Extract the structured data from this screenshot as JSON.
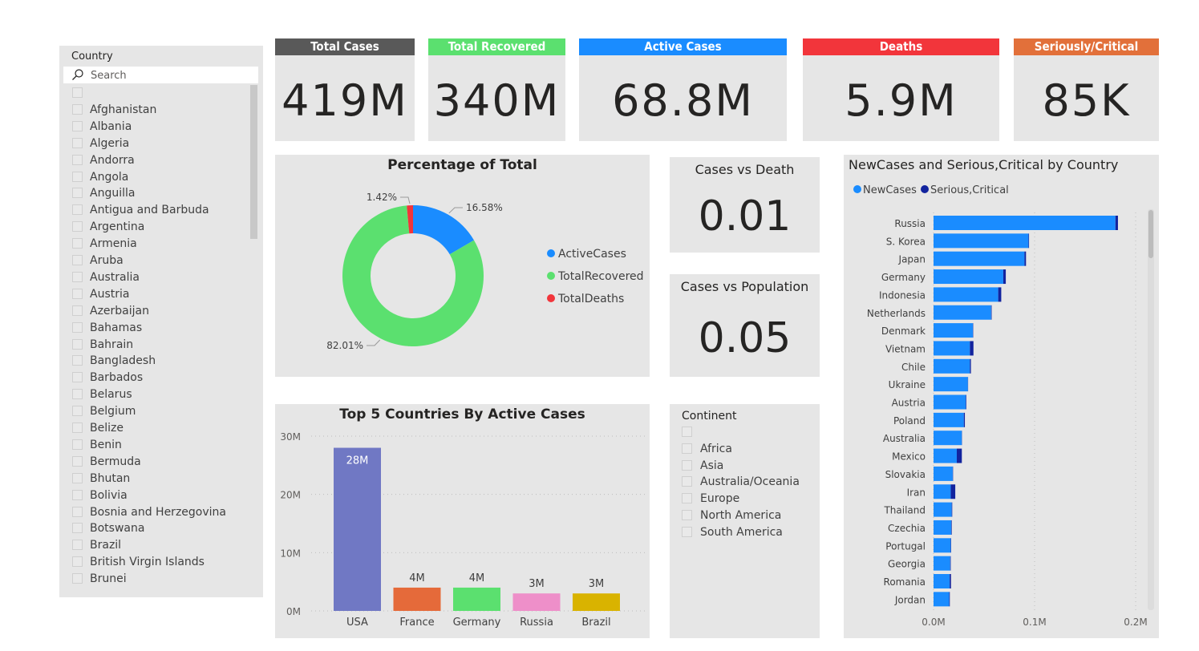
{
  "country_slicer": {
    "title": "Country",
    "search_placeholder": "Search",
    "items": [
      "",
      "Afghanistan",
      "Albania",
      "Algeria",
      "Andorra",
      "Angola",
      "Anguilla",
      "Antigua and Barbuda",
      "Argentina",
      "Armenia",
      "Aruba",
      "Australia",
      "Austria",
      "Azerbaijan",
      "Bahamas",
      "Bahrain",
      "Bangladesh",
      "Barbados",
      "Belarus",
      "Belgium",
      "Belize",
      "Benin",
      "Bermuda",
      "Bhutan",
      "Bolivia",
      "Bosnia and Herzegovina",
      "Botswana",
      "Brazil",
      "British Virgin Islands",
      "Brunei"
    ]
  },
  "kpis": {
    "total_cases": {
      "label": "Total Cases",
      "value": "419M",
      "color": "#595959"
    },
    "total_recovered": {
      "label": "Total Recovered",
      "value": "340M",
      "color": "#5be06f"
    },
    "active_cases": {
      "label": "Active Cases",
      "value": "68.8M",
      "color": "#1a8cff"
    },
    "deaths": {
      "label": "Deaths",
      "value": "5.9M",
      "color": "#f2353b"
    },
    "serious_critical": {
      "label": "Seriously/Critical",
      "value": "85K",
      "color": "#e2703a"
    }
  },
  "ratios": {
    "cases_vs_death": {
      "title": "Cases vs Death",
      "value": "0.01"
    },
    "cases_vs_population": {
      "title": "Cases vs Population",
      "value": "0.05"
    }
  },
  "continent_slicer": {
    "title": "Continent",
    "items": [
      "",
      "Africa",
      "Asia",
      "Australia/Oceania",
      "Europe",
      "North America",
      "South America"
    ]
  },
  "chart_data": [
    {
      "type": "pie",
      "title": "Percentage of Total",
      "donut": true,
      "slices": [
        {
          "name": "ActiveCases",
          "value": 16.58,
          "label": "16.58%",
          "color": "#1a8cff"
        },
        {
          "name": "TotalRecovered",
          "value": 82.01,
          "label": "82.01%",
          "color": "#5be06f"
        },
        {
          "name": "TotalDeaths",
          "value": 1.42,
          "label": "1.42%",
          "color": "#f2353b"
        }
      ],
      "legend_position": "right"
    },
    {
      "type": "bar",
      "title": "Top 5 Countries By Active Cases",
      "categories": [
        "USA",
        "France",
        "Germany",
        "Russia",
        "Brazil"
      ],
      "values": [
        28000000,
        4000000,
        4000000,
        3000000,
        3000000
      ],
      "data_labels": [
        "28M",
        "4M",
        "4M",
        "3M",
        "3M"
      ],
      "colors": [
        "#7078c4",
        "#e56a3a",
        "#5be06f",
        "#ee8fc9",
        "#d9b300"
      ],
      "yticks": [
        "0M",
        "10M",
        "20M",
        "30M"
      ],
      "ylim": [
        0,
        30000000
      ],
      "grid": true
    },
    {
      "type": "bar",
      "orientation": "horizontal",
      "stacked": true,
      "title": "NewCases and Serious,Critical by Country",
      "legend_position": "top-left",
      "categories": [
        "Russia",
        "S. Korea",
        "Japan",
        "Germany",
        "Indonesia",
        "Netherlands",
        "Denmark",
        "Vietnam",
        "Chile",
        "Ukraine",
        "Austria",
        "Poland",
        "Australia",
        "Mexico",
        "Slovakia",
        "Iran",
        "Thailand",
        "Czechia",
        "Portugal",
        "Georgia",
        "Romania",
        "Jordan"
      ],
      "series": [
        {
          "name": "NewCases",
          "color": "#1a8cff",
          "values": [
            180000,
            94000,
            90000,
            69000,
            64000,
            57000,
            39000,
            36000,
            36000,
            34000,
            32000,
            30000,
            28000,
            23000,
            19000,
            17000,
            18000,
            17500,
            17000,
            16500,
            16000,
            15500
          ]
        },
        {
          "name": "Serious,Critical",
          "color": "#12239e",
          "values": [
            2500,
            500,
            1500,
            2500,
            3000,
            500,
            300,
            3500,
            1000,
            200,
            500,
            1000,
            200,
            5000,
            300,
            4500,
            500,
            500,
            400,
            500,
            1300,
            600
          ]
        }
      ],
      "xticks": [
        "0.0M",
        "0.1M",
        "0.2M"
      ],
      "xlim": [
        0,
        200000
      ],
      "grid": true
    }
  ]
}
